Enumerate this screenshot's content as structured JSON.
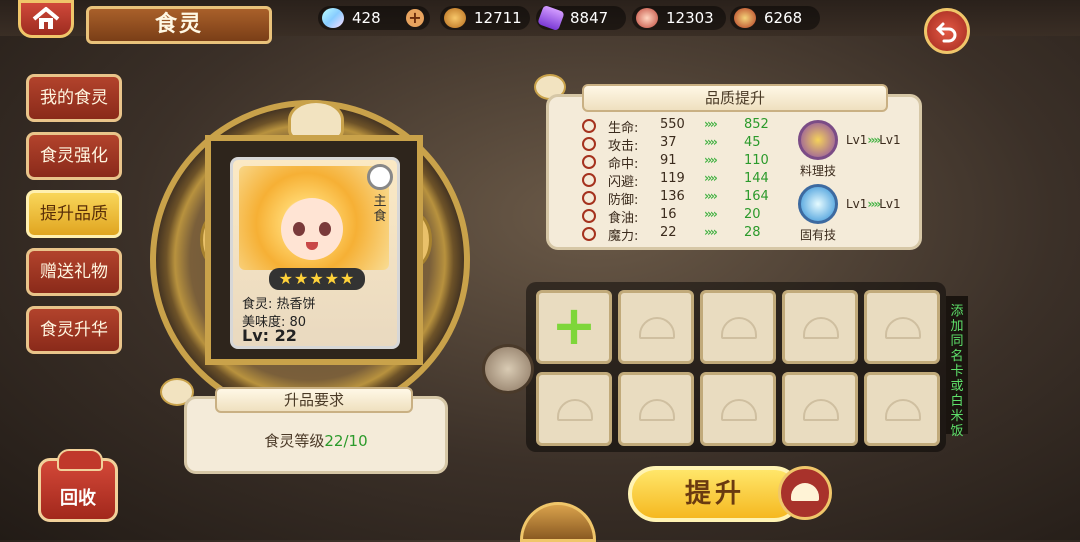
{
  "header": {
    "title": "食灵",
    "resources": [
      {
        "icon": "diamond-icon",
        "value": "428",
        "plus": "+"
      },
      {
        "icon": "oil-flask-icon",
        "value": "12711"
      },
      {
        "icon": "purple-crystal-icon",
        "value": "8847"
      },
      {
        "icon": "meat-icon",
        "value": "12303"
      },
      {
        "icon": "food-bowl-icon",
        "value": "6268"
      }
    ],
    "back_icon": "back-arrow-icon",
    "home_icon": "home-icon"
  },
  "menu": {
    "items": [
      {
        "label": "我的食灵"
      },
      {
        "label": "食灵强化"
      },
      {
        "label": "提升品质"
      },
      {
        "label": "赠送礼物"
      },
      {
        "label": "食灵升华"
      }
    ],
    "active_index": 2,
    "recycle_label": "回收"
  },
  "card": {
    "tag_vertical": "主食",
    "name_line": "食灵: 热香饼",
    "taste_line": "美味度: 80",
    "level_line": "Lv: 22",
    "stars": "★★★★★",
    "star_count": 5
  },
  "requirement": {
    "title": "升品要求",
    "text": "食灵等级",
    "value": "22/10"
  },
  "quality": {
    "title": "品质提升",
    "arrow": "››››",
    "stats": [
      {
        "name": "生命:",
        "before": "550",
        "after": "852"
      },
      {
        "name": "攻击:",
        "before": "37",
        "after": "45"
      },
      {
        "name": "命中:",
        "before": "91",
        "after": "110"
      },
      {
        "name": "闪避:",
        "before": "119",
        "after": "144"
      },
      {
        "name": "防御:",
        "before": "136",
        "after": "164"
      },
      {
        "name": "食油:",
        "before": "16",
        "after": "20"
      },
      {
        "name": "魔力:",
        "before": "22",
        "after": "28"
      }
    ],
    "skills": [
      {
        "label": "料理技",
        "from": "Lv1",
        "to": "Lv1",
        "icon": "cooking-skill-icon"
      },
      {
        "label": "固有技",
        "from": "Lv1",
        "to": "Lv1",
        "icon": "innate-skill-icon"
      }
    ]
  },
  "slots": {
    "add_symbol": "+",
    "count": 10,
    "hint": "添加同名卡或白米饭"
  },
  "action": {
    "upgrade_label": "提升"
  },
  "colors": {
    "accent_gold": "#c9a24a",
    "menu_red": "#a2281c",
    "active_yellow": "#f5b820",
    "increase_green": "#2b9a2b"
  }
}
